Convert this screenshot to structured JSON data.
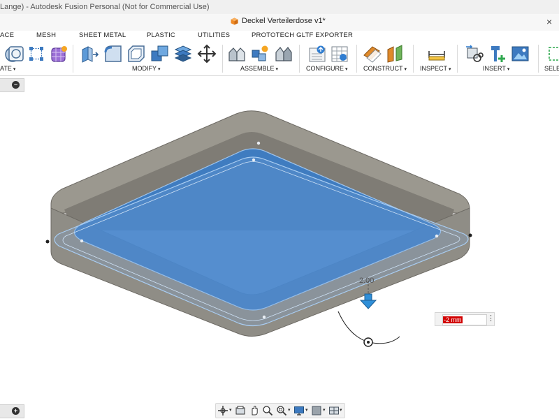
{
  "window": {
    "title": "Lange) - Autodesk Fusion Personal (Not for Commercial Use)"
  },
  "document": {
    "tab_title": "Deckel Verteilerdose v1*",
    "close_glyph": "×"
  },
  "tabs": [
    "ACE",
    "MESH",
    "SHEET METAL",
    "PLASTIC",
    "UTILITIES",
    "PROTOTECH GLTF EXPORTER"
  ],
  "groups": {
    "create": "ATE",
    "modify": "MODIFY",
    "assemble": "ASSEMBLE",
    "configure": "CONFIGURE",
    "construct": "CONSTRUCT",
    "inspect": "INSPECT",
    "insert": "INSERT",
    "select": "SELE"
  },
  "caret": "▾",
  "tools": {
    "create": [
      "revolve-icon",
      "coil-icon",
      "sketch-points-icon",
      "form-icon"
    ],
    "modify": [
      "press-pull-icon",
      "fillet-icon",
      "shell-icon",
      "combine-icon",
      "offset-face-icon",
      "move-icon"
    ],
    "assemble": [
      "joint-icon",
      "new-component-icon",
      "as-built-joint-icon"
    ],
    "configure": [
      "configure-icon",
      "configure-table-icon"
    ],
    "construct": [
      "offset-plane-icon",
      "midplane-icon"
    ],
    "inspect": [
      "measure-icon"
    ],
    "insert": [
      "insert-derive-icon",
      "insert-mcmaster-icon",
      "insert-image-icon"
    ]
  },
  "browser": {
    "collapse_glyph": "−",
    "expand_glyph": "+"
  },
  "dimension": {
    "value": "-2 mm",
    "label": "2.00"
  },
  "colors": {
    "selection_blue": "#3a7cc7",
    "part_gray": "#8f8d86",
    "edit_highlight": "#d10000"
  },
  "navbar": {
    "tools": [
      "orbit-icon",
      "look-at-icon",
      "pan-icon",
      "zoom-icon",
      "zoom-window-icon",
      "display-settings-icon",
      "grid-icon",
      "viewports-icon"
    ]
  }
}
